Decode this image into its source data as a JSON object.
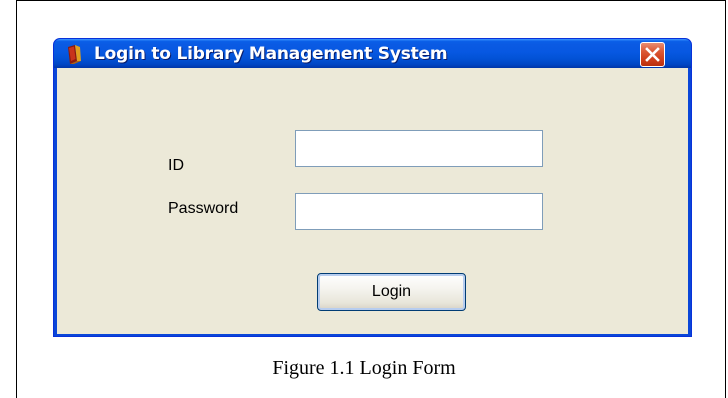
{
  "window": {
    "title": "Login to Library Management System",
    "icons": {
      "app": "book-icon",
      "close": "close-icon"
    }
  },
  "form": {
    "id_label": "ID",
    "id_value": "",
    "password_label": "Password",
    "password_value": "",
    "login_label": "Login"
  },
  "caption": "Figure 1.1 Login Form",
  "colors": {
    "titlebar": "#0a5ae3",
    "client_background": "#ece9d8",
    "close_button": "#dc5a37",
    "field_border": "#7f9db9"
  }
}
